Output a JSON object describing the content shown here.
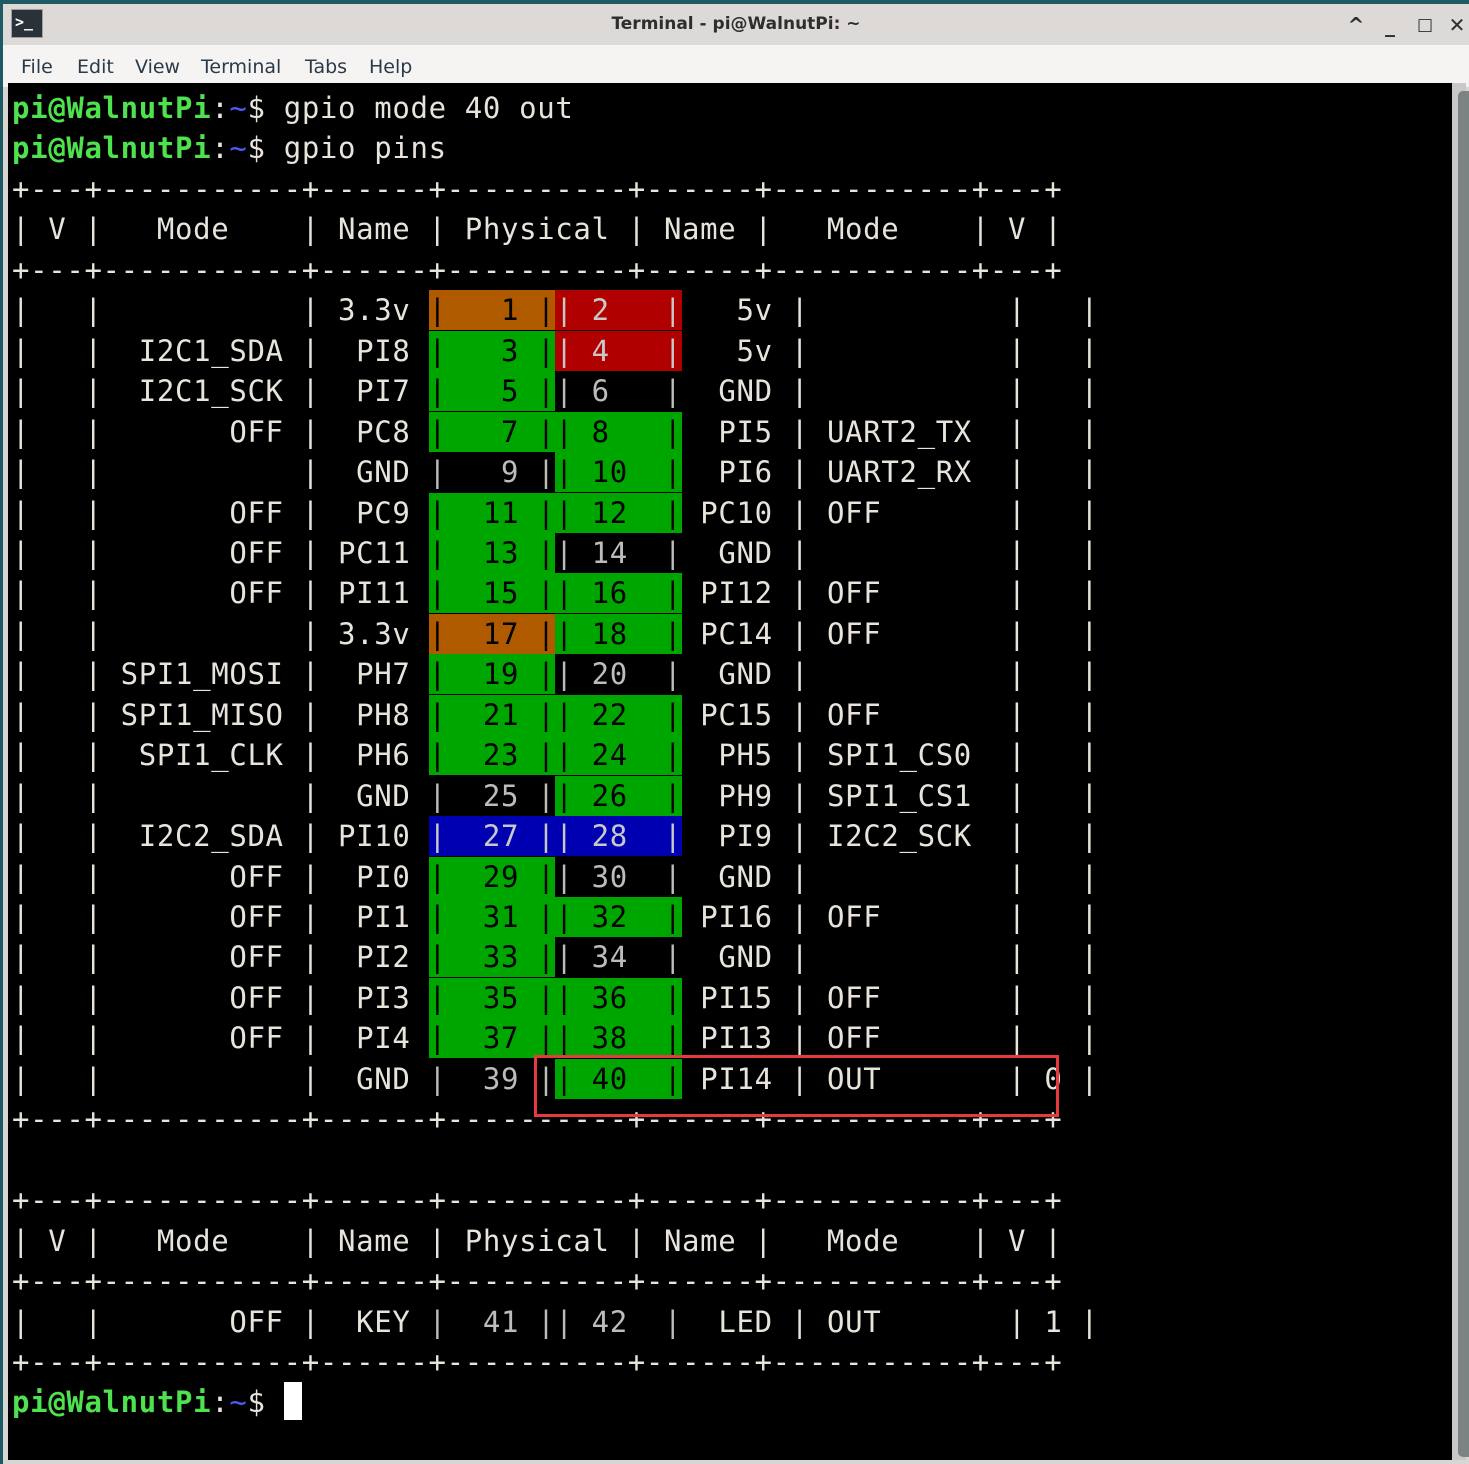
{
  "window": {
    "title": "Terminal - pi@WalnutPi: ~",
    "app_icon": ">_",
    "controls": {
      "shade": "^",
      "minimize": "_",
      "maximize": "□",
      "close": "✕"
    }
  },
  "menubar": {
    "items": [
      "File",
      "Edit",
      "View",
      "Terminal",
      "Tabs",
      "Help"
    ]
  },
  "prompt": {
    "user_host": "pi@WalnutPi",
    "colon": ":",
    "path": "~",
    "symbol": "$"
  },
  "commands": [
    "gpio mode 40 out",
    "gpio pins"
  ],
  "colors": {
    "prompt_green": "#4fe24f",
    "path_blue": "#4a5cf5",
    "pin_gpio": "#00a600",
    "pin_3v3": "#b05a00",
    "pin_5v": "#b00000",
    "pin_i2c2": "#0000b3",
    "highlight": "#e8393c"
  },
  "table_main": {
    "border": "+---+-----------+------+----------+------+-----------+---+",
    "headers": [
      "V",
      "Mode",
      "Name",
      "Physical",
      "Name",
      "Mode",
      "V"
    ],
    "rows": [
      {
        "lv": "",
        "lmode": "",
        "lname": "3.3v",
        "lpin": "1",
        "lcolor": "orange",
        "rpin": "2",
        "rcolor": "red",
        "rname": "5v",
        "rmode": "",
        "rv": ""
      },
      {
        "lv": "",
        "lmode": "I2C1_SDA",
        "lname": "PI8",
        "lpin": "3",
        "lcolor": "green",
        "rpin": "4",
        "rcolor": "red",
        "rname": "5v",
        "rmode": "",
        "rv": ""
      },
      {
        "lv": "",
        "lmode": "I2C1_SCK",
        "lname": "PI7",
        "lpin": "5",
        "lcolor": "green",
        "rpin": "6",
        "rcolor": "none",
        "rname": "GND",
        "rmode": "",
        "rv": ""
      },
      {
        "lv": "",
        "lmode": "OFF",
        "lname": "PC8",
        "lpin": "7",
        "lcolor": "green",
        "rpin": "8",
        "rcolor": "green",
        "rname": "PI5",
        "rmode": "UART2_TX",
        "rv": ""
      },
      {
        "lv": "",
        "lmode": "",
        "lname": "GND",
        "lpin": "9",
        "lcolor": "none",
        "rpin": "10",
        "rcolor": "green",
        "rname": "PI6",
        "rmode": "UART2_RX",
        "rv": ""
      },
      {
        "lv": "",
        "lmode": "OFF",
        "lname": "PC9",
        "lpin": "11",
        "lcolor": "green",
        "rpin": "12",
        "rcolor": "green",
        "rname": "PC10",
        "rmode": "OFF",
        "rv": ""
      },
      {
        "lv": "",
        "lmode": "OFF",
        "lname": "PC11",
        "lpin": "13",
        "lcolor": "green",
        "rpin": "14",
        "rcolor": "none",
        "rname": "GND",
        "rmode": "",
        "rv": ""
      },
      {
        "lv": "",
        "lmode": "OFF",
        "lname": "PI11",
        "lpin": "15",
        "lcolor": "green",
        "rpin": "16",
        "rcolor": "green",
        "rname": "PI12",
        "rmode": "OFF",
        "rv": ""
      },
      {
        "lv": "",
        "lmode": "",
        "lname": "3.3v",
        "lpin": "17",
        "lcolor": "orange",
        "rpin": "18",
        "rcolor": "green",
        "rname": "PC14",
        "rmode": "OFF",
        "rv": ""
      },
      {
        "lv": "",
        "lmode": "SPI1_MOSI",
        "lname": "PH7",
        "lpin": "19",
        "lcolor": "green",
        "rpin": "20",
        "rcolor": "none",
        "rname": "GND",
        "rmode": "",
        "rv": ""
      },
      {
        "lv": "",
        "lmode": "SPI1_MISO",
        "lname": "PH8",
        "lpin": "21",
        "lcolor": "green",
        "rpin": "22",
        "rcolor": "green",
        "rname": "PC15",
        "rmode": "OFF",
        "rv": ""
      },
      {
        "lv": "",
        "lmode": "SPI1_CLK",
        "lname": "PH6",
        "lpin": "23",
        "lcolor": "green",
        "rpin": "24",
        "rcolor": "green",
        "rname": "PH5",
        "rmode": "SPI1_CS0",
        "rv": ""
      },
      {
        "lv": "",
        "lmode": "",
        "lname": "GND",
        "lpin": "25",
        "lcolor": "none",
        "rpin": "26",
        "rcolor": "green",
        "rname": "PH9",
        "rmode": "SPI1_CS1",
        "rv": ""
      },
      {
        "lv": "",
        "lmode": "I2C2_SDA",
        "lname": "PI10",
        "lpin": "27",
        "lcolor": "blue",
        "rpin": "28",
        "rcolor": "blue",
        "rname": "PI9",
        "rmode": "I2C2_SCK",
        "rv": ""
      },
      {
        "lv": "",
        "lmode": "OFF",
        "lname": "PI0",
        "lpin": "29",
        "lcolor": "green",
        "rpin": "30",
        "rcolor": "none",
        "rname": "GND",
        "rmode": "",
        "rv": ""
      },
      {
        "lv": "",
        "lmode": "OFF",
        "lname": "PI1",
        "lpin": "31",
        "lcolor": "green",
        "rpin": "32",
        "rcolor": "green",
        "rname": "PI16",
        "rmode": "OFF",
        "rv": ""
      },
      {
        "lv": "",
        "lmode": "OFF",
        "lname": "PI2",
        "lpin": "33",
        "lcolor": "green",
        "rpin": "34",
        "rcolor": "none",
        "rname": "GND",
        "rmode": "",
        "rv": ""
      },
      {
        "lv": "",
        "lmode": "OFF",
        "lname": "PI3",
        "lpin": "35",
        "lcolor": "green",
        "rpin": "36",
        "rcolor": "green",
        "rname": "PI15",
        "rmode": "OFF",
        "rv": ""
      },
      {
        "lv": "",
        "lmode": "OFF",
        "lname": "PI4",
        "lpin": "37",
        "lcolor": "green",
        "rpin": "38",
        "rcolor": "green",
        "rname": "PI13",
        "rmode": "OFF",
        "rv": ""
      },
      {
        "lv": "",
        "lmode": "",
        "lname": "GND",
        "lpin": "39",
        "lcolor": "none",
        "rpin": "40",
        "rcolor": "green",
        "rname": "PI14",
        "rmode": "OUT",
        "rv": "0",
        "highlighted": true
      }
    ]
  },
  "table_extra": {
    "border": "+---+-----------+------+----------+------+-----------+---+",
    "headers": [
      "V",
      "Mode",
      "Name",
      "Physical",
      "Name",
      "Mode",
      "V"
    ],
    "rows": [
      {
        "lv": "",
        "lmode": "OFF",
        "lname": "KEY",
        "lpin": "41",
        "lcolor": "none",
        "rpin": "42",
        "rcolor": "none",
        "rname": "LED",
        "rmode": "OUT",
        "rv": "1"
      }
    ]
  }
}
